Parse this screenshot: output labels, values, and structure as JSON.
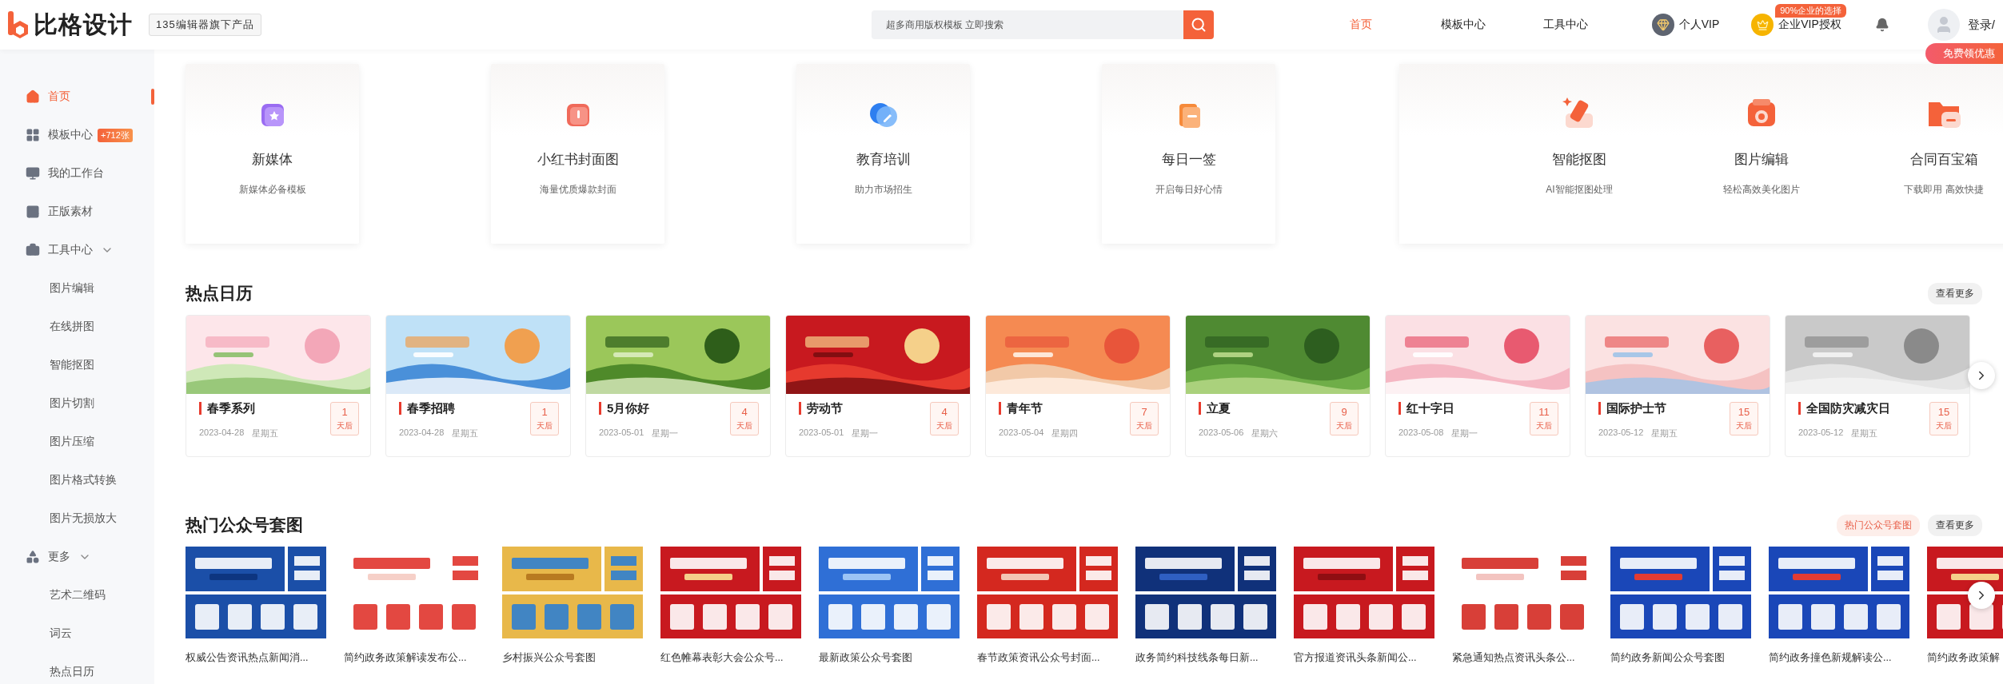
{
  "header": {
    "logo": "比格设计",
    "tagline": "135编辑器旗下产品",
    "search": {
      "placeholder": "超多商用版权模板 立即搜索"
    },
    "nav": [
      {
        "label": "首页",
        "selected": true
      },
      {
        "label": "模板中心",
        "selected": false
      },
      {
        "label": "工具中心",
        "selected": false
      }
    ],
    "vip": [
      {
        "kind": "personal",
        "label": "个人VIP"
      },
      {
        "kind": "enterprise",
        "label": "企业VIP授权",
        "badge": "90%企业的选择"
      }
    ],
    "login": "登录/",
    "promo": "免费领优惠"
  },
  "sidebar": {
    "items": [
      {
        "kind": "main",
        "label": "首页",
        "selected": true
      },
      {
        "kind": "main",
        "label": "模板中心",
        "selected": false,
        "badge": "+712张"
      },
      {
        "kind": "main",
        "label": "我的工作台",
        "selected": false
      },
      {
        "kind": "main",
        "label": "正版素材",
        "selected": false
      },
      {
        "kind": "group",
        "label": "工具中心",
        "selected": false
      },
      {
        "kind": "sub",
        "label": "图片编辑",
        "selected": false
      },
      {
        "kind": "sub",
        "label": "在线拼图",
        "selected": false
      },
      {
        "kind": "sub",
        "label": "智能抠图",
        "selected": false
      },
      {
        "kind": "sub",
        "label": "图片切割",
        "selected": false
      },
      {
        "kind": "sub",
        "label": "图片压缩",
        "selected": false
      },
      {
        "kind": "sub",
        "label": "图片格式转换",
        "selected": false
      },
      {
        "kind": "sub",
        "label": "图片无损放大",
        "selected": false
      },
      {
        "kind": "group",
        "label": "更多",
        "selected": false
      },
      {
        "kind": "sub",
        "label": "艺术二维码",
        "selected": false
      },
      {
        "kind": "sub",
        "label": "词云",
        "selected": false
      },
      {
        "kind": "sub",
        "label": "热点日历",
        "selected": false
      }
    ]
  },
  "features": [
    {
      "title": "新媒体",
      "subtitle": "新媒体必备模板"
    },
    {
      "title": "小红书封面图",
      "subtitle": "海量优质爆款封面"
    },
    {
      "title": "教育培训",
      "subtitle": "助力市场招生"
    },
    {
      "title": "每日一签",
      "subtitle": "开启每日好心情"
    }
  ],
  "tools": [
    {
      "title": "智能抠图",
      "subtitle": "AI智能抠图处理"
    },
    {
      "title": "图片编辑",
      "subtitle": "轻松高效美化图片"
    },
    {
      "title": "合同百宝箱",
      "subtitle": "下载即用 高效快捷"
    }
  ],
  "calendar": {
    "title": "热点日历",
    "more": "查看更多",
    "events": [
      {
        "title": "春季系列",
        "date": "2023-04-28",
        "weekday": "星期五",
        "days": "1",
        "unit": "天后"
      },
      {
        "title": "春季招聘",
        "date": "2023-04-28",
        "weekday": "星期五",
        "days": "1",
        "unit": "天后"
      },
      {
        "title": "5月你好",
        "date": "2023-05-01",
        "weekday": "星期一",
        "days": "4",
        "unit": "天后"
      },
      {
        "title": "劳动节",
        "date": "2023-05-01",
        "weekday": "星期一",
        "days": "4",
        "unit": "天后"
      },
      {
        "title": "青年节",
        "date": "2023-05-04",
        "weekday": "星期四",
        "days": "7",
        "unit": "天后"
      },
      {
        "title": "立夏",
        "date": "2023-05-06",
        "weekday": "星期六",
        "days": "9",
        "unit": "天后"
      },
      {
        "title": "红十字日",
        "date": "2023-05-08",
        "weekday": "星期一",
        "days": "11",
        "unit": "天后"
      },
      {
        "title": "国际护士节",
        "date": "2023-05-12",
        "weekday": "星期五",
        "days": "15",
        "unit": "天后"
      },
      {
        "title": "全国防灾减灾日",
        "date": "2023-05-12",
        "weekday": "星期五",
        "days": "15",
        "unit": "天后"
      }
    ]
  },
  "templates": {
    "title": "热门公众号套图",
    "tag": "热门公众号套图",
    "more": "查看更多",
    "items": [
      {
        "caption": "权威公告资讯热点新闻消..."
      },
      {
        "caption": "简约政务政策解读发布公..."
      },
      {
        "caption": "乡村振兴公众号套图"
      },
      {
        "caption": "红色帷幕表彰大会公众号..."
      },
      {
        "caption": "最新政策公众号套图"
      },
      {
        "caption": "春节政策资讯公众号封面..."
      },
      {
        "caption": "政务简约科技线条每日新..."
      },
      {
        "caption": "官方报道资讯头条新闻公..."
      },
      {
        "caption": "紧急通知热点资讯头条公..."
      },
      {
        "caption": "简约政务新闻公众号套图"
      },
      {
        "caption": "简约政务撞色新规解读公..."
      },
      {
        "caption": "简约政务政策解"
      }
    ]
  }
}
